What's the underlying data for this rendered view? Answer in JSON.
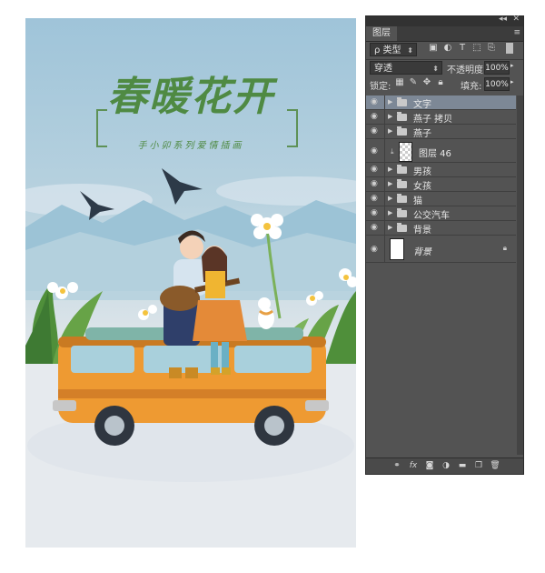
{
  "poster": {
    "title": "春暖花开",
    "subtitle": "手小卯系列爱情插画"
  },
  "panel": {
    "tab_label": "图层",
    "filter_label": "ρ 类型",
    "blend_mode": "穿透",
    "opacity_label": "不透明度:",
    "opacity_value": "100%",
    "lock_label": "锁定:",
    "fill_label": "填充:",
    "fill_value": "100%",
    "layers": [
      {
        "name": "文字",
        "kind": "group",
        "selected": true
      },
      {
        "name": "燕子 拷贝",
        "kind": "group",
        "selected": false
      },
      {
        "name": "燕子",
        "kind": "group",
        "selected": false
      },
      {
        "name": "图层 46",
        "kind": "pixel",
        "selected": false
      },
      {
        "name": "男孩",
        "kind": "group",
        "selected": false
      },
      {
        "name": "女孩",
        "kind": "group",
        "selected": false
      },
      {
        "name": "猫",
        "kind": "group",
        "selected": false
      },
      {
        "name": "公交汽车",
        "kind": "group",
        "selected": false
      },
      {
        "name": "背景",
        "kind": "group",
        "selected": false
      },
      {
        "name": "背景",
        "kind": "background",
        "selected": false
      }
    ],
    "icons": {
      "visibility": "eye-icon",
      "group": "folder-icon",
      "lock": "lock-icon"
    }
  }
}
